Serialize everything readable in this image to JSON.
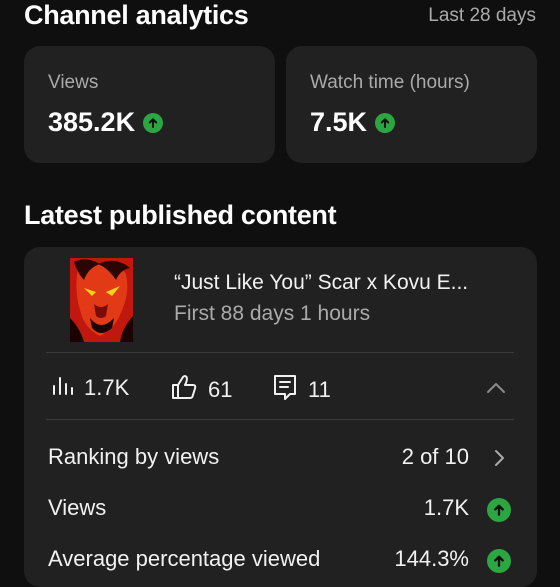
{
  "header": {
    "title": "Channel analytics",
    "period": "Last 28 days"
  },
  "summary": [
    {
      "label": "Views",
      "value": "385.2K"
    },
    {
      "label": "Watch time (hours)",
      "value": "7.5K"
    }
  ],
  "latest": {
    "section_title": "Latest published content",
    "video_title": "“Just Like You” Scar x Kovu E...",
    "video_meta": "First 88 days 1 hours",
    "stats": {
      "views": "1.7K",
      "likes": "61",
      "comments": "11"
    },
    "rows": [
      {
        "label": "Ranking by views",
        "value": "2 of 10"
      },
      {
        "label": "Views",
        "value": "1.7K"
      },
      {
        "label": "Average percentage viewed",
        "value": "144.3%"
      }
    ]
  },
  "colors": {
    "accent_up": "#2ba640",
    "card": "#212121",
    "bg": "#0f0f0f"
  },
  "icons": [
    "arrow-up-icon",
    "bar-chart-icon",
    "thumbs-up-icon",
    "comment-icon",
    "chevron-up-icon",
    "chevron-right-icon"
  ]
}
